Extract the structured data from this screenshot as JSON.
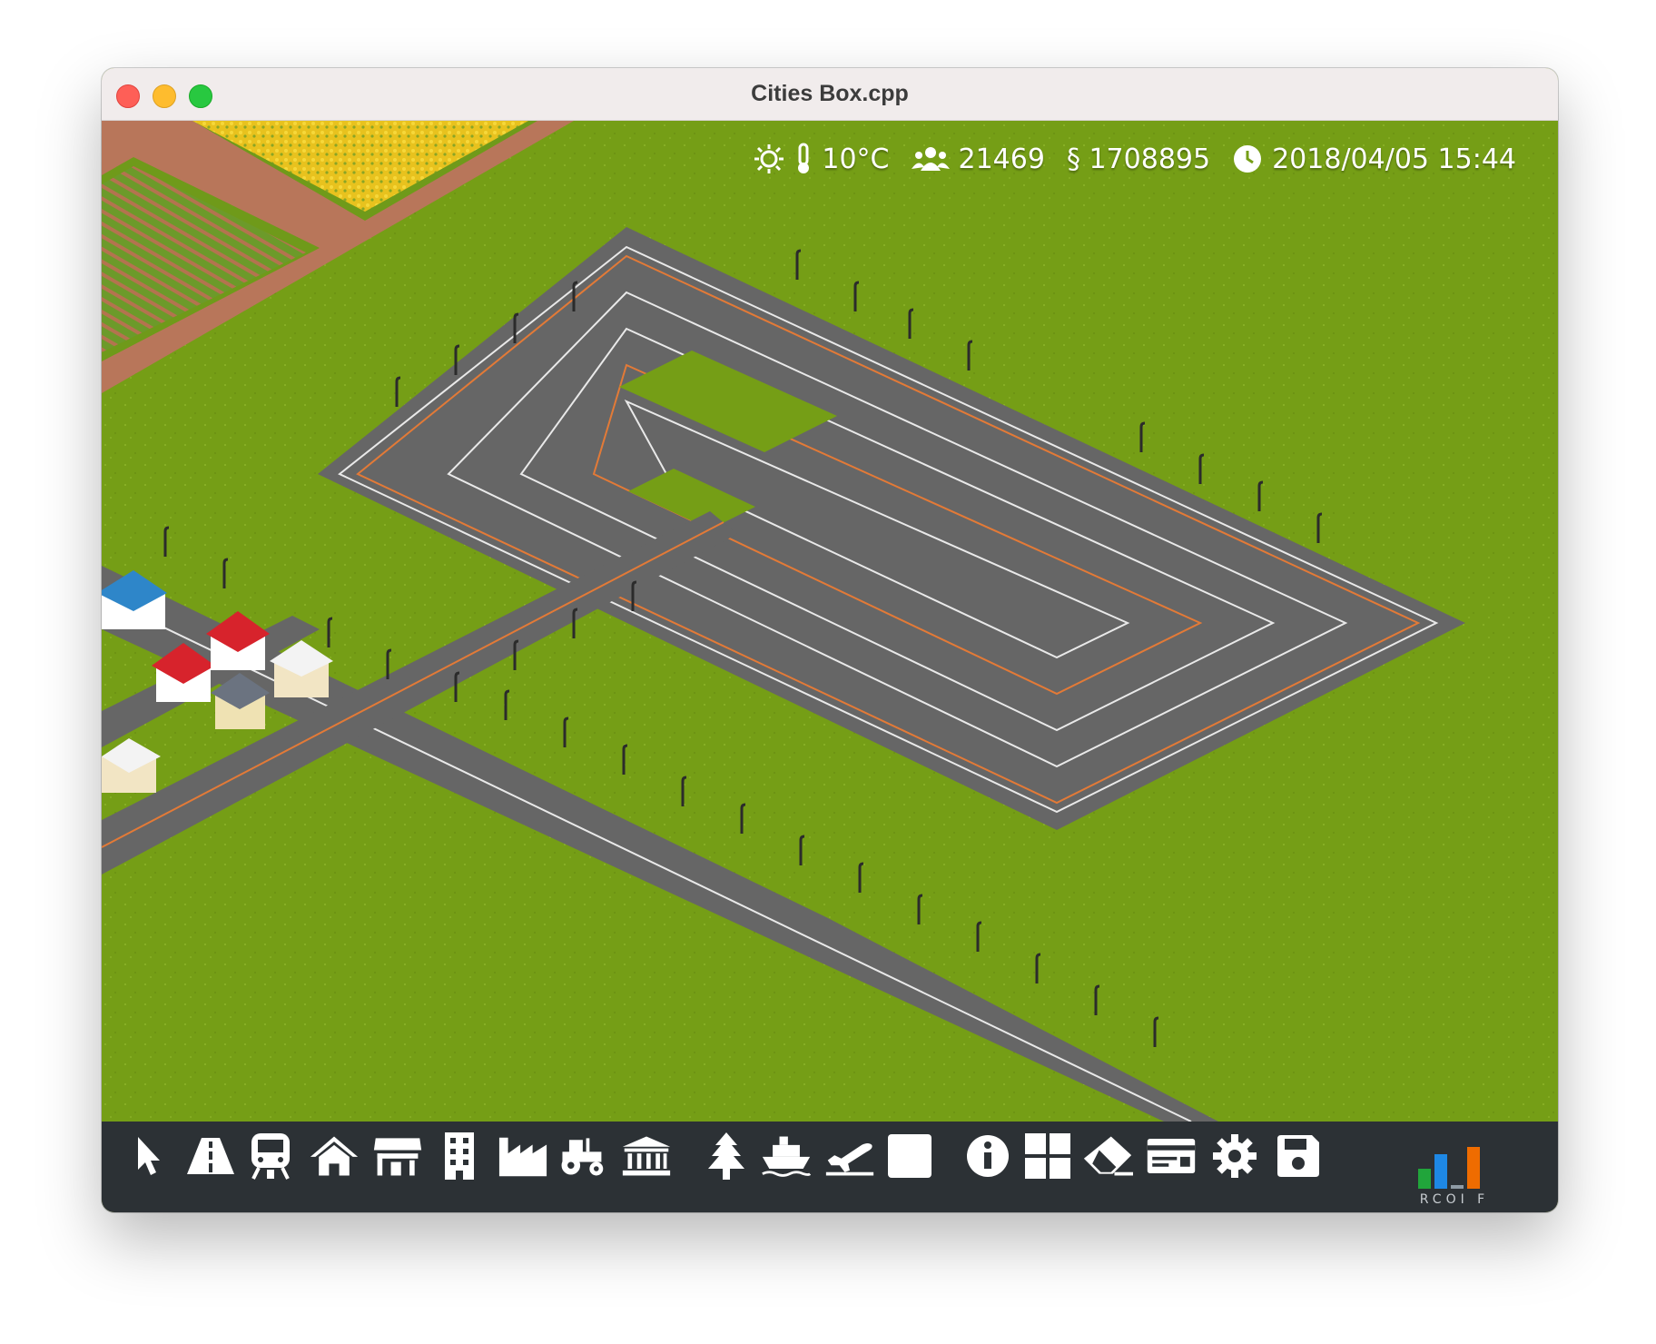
{
  "window": {
    "title": "Cities Box.cpp"
  },
  "hud": {
    "weather_icon": "sun-icon",
    "temperature": "10°C",
    "population": "21469",
    "money": "§ 1708895",
    "datetime": "2018/04/05 15:44"
  },
  "toolbar": {
    "tools": [
      {
        "name": "select-tool",
        "icon": "cursor-icon"
      },
      {
        "name": "road-tool",
        "icon": "road-icon"
      },
      {
        "name": "rail-tool",
        "icon": "train-icon"
      },
      {
        "name": "residential-tool",
        "icon": "house-icon"
      },
      {
        "name": "commercial-tool",
        "icon": "shop-icon"
      },
      {
        "name": "office-tool",
        "icon": "office-building-icon"
      },
      {
        "name": "industrial-tool",
        "icon": "factory-icon"
      },
      {
        "name": "agriculture-tool",
        "icon": "tractor-icon"
      },
      {
        "name": "government-tool",
        "icon": "government-building-icon"
      },
      {
        "name": "parks-tool",
        "icon": "tree-icon"
      },
      {
        "name": "port-tool",
        "icon": "ship-icon"
      },
      {
        "name": "airport-tool",
        "icon": "airplane-icon"
      },
      {
        "name": "zone-tool",
        "icon": "blank-square-icon"
      },
      {
        "name": "info-tool",
        "icon": "info-icon"
      },
      {
        "name": "overlay-tool",
        "icon": "grid-icon"
      },
      {
        "name": "bulldoze-tool",
        "icon": "eraser-icon"
      },
      {
        "name": "budget-tool",
        "icon": "card-icon"
      },
      {
        "name": "settings-tool",
        "icon": "gear-icon"
      },
      {
        "name": "save-tool",
        "icon": "floppy-disk-icon"
      }
    ],
    "demand": {
      "label": "RCOI F",
      "colors": {
        "residential": "#21a53b",
        "commercial": "#1e88e5",
        "industrial": "#ef6c00"
      }
    }
  }
}
